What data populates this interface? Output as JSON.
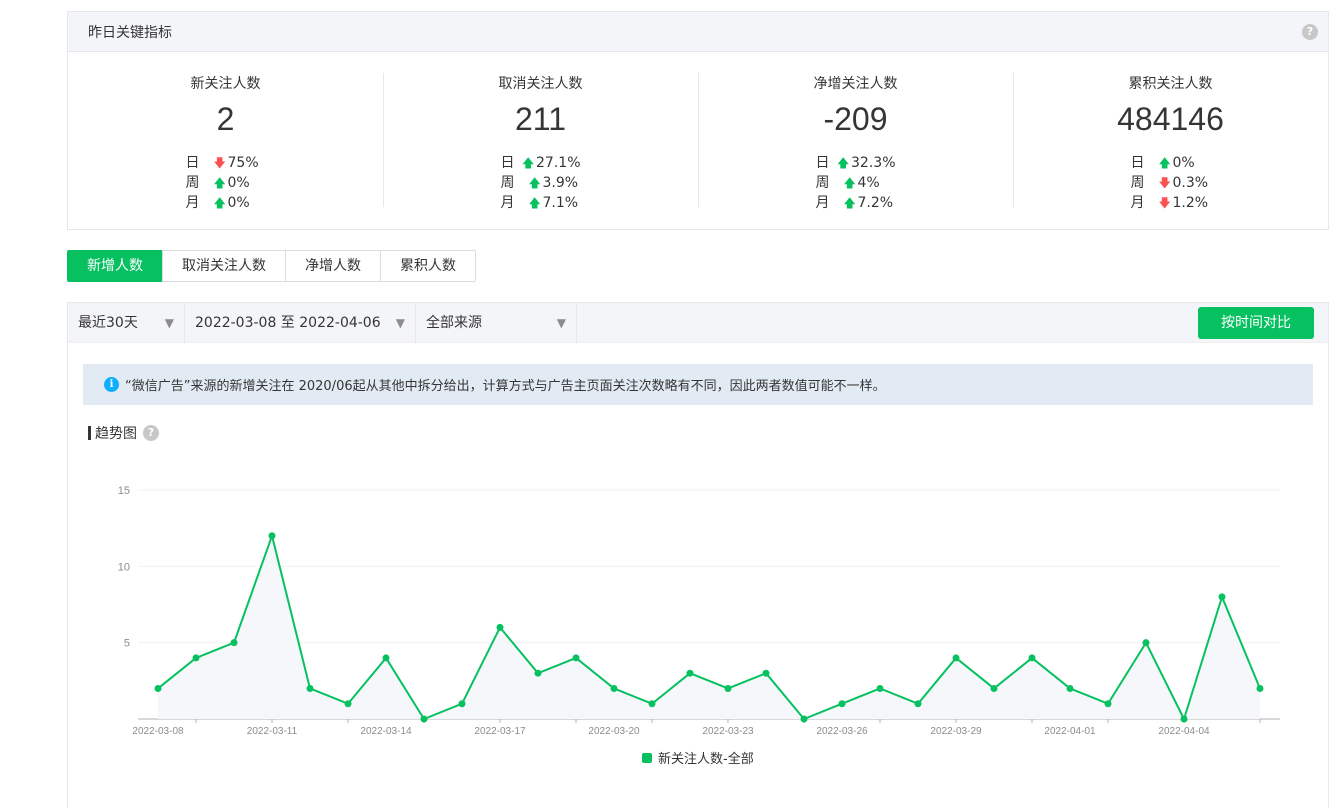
{
  "kpi": {
    "header": "昨日关键指标",
    "help_icon": "?",
    "metrics": [
      {
        "title": "新关注人数",
        "value": "2",
        "changes": [
          {
            "period": "日",
            "direction": "down",
            "pct": "75%"
          },
          {
            "period": "周",
            "direction": "up",
            "pct": "0%"
          },
          {
            "period": "月",
            "direction": "up",
            "pct": "0%"
          }
        ]
      },
      {
        "title": "取消关注人数",
        "value": "211",
        "changes": [
          {
            "period": "日",
            "direction": "up",
            "pct": "27.1%"
          },
          {
            "period": "周",
            "direction": "up",
            "pct": "3.9%"
          },
          {
            "period": "月",
            "direction": "up",
            "pct": "7.1%"
          }
        ]
      },
      {
        "title": "净增关注人数",
        "value": "-209",
        "changes": [
          {
            "period": "日",
            "direction": "up",
            "pct": "32.3%"
          },
          {
            "period": "周",
            "direction": "up",
            "pct": "4%"
          },
          {
            "period": "月",
            "direction": "up",
            "pct": "7.2%"
          }
        ]
      },
      {
        "title": "累积关注人数",
        "value": "484146",
        "changes": [
          {
            "period": "日",
            "direction": "up",
            "pct": "0%"
          },
          {
            "period": "周",
            "direction": "down",
            "pct": "0.3%"
          },
          {
            "period": "月",
            "direction": "down",
            "pct": "1.2%"
          }
        ]
      }
    ]
  },
  "tabs": [
    {
      "label": "新增人数",
      "active": true
    },
    {
      "label": "取消关注人数",
      "active": false
    },
    {
      "label": "净增人数",
      "active": false
    },
    {
      "label": "累积人数",
      "active": false
    }
  ],
  "filters": {
    "range": "最近30天",
    "dates": "2022-03-08 至 2022-04-06",
    "source": "全部来源",
    "compare_button": "按时间对比"
  },
  "notice": {
    "icon": "i",
    "text": "“微信广告”来源的新增关注在 2020/06起从其他中拆分给出，计算方式与广告主页面关注次数略有不同，因此两者数值可能不一样。"
  },
  "trend": {
    "title": "趋势图",
    "help_icon": "?"
  },
  "colors": {
    "accent": "#07c160",
    "down": "#fa5151",
    "notice_bg": "#e2ebf4",
    "info": "#10aeff"
  },
  "chart_data": {
    "type": "line",
    "x": [
      "2022-03-08",
      "2022-03-09",
      "2022-03-10",
      "2022-03-11",
      "2022-03-12",
      "2022-03-13",
      "2022-03-14",
      "2022-03-15",
      "2022-03-16",
      "2022-03-17",
      "2022-03-18",
      "2022-03-19",
      "2022-03-20",
      "2022-03-21",
      "2022-03-22",
      "2022-03-23",
      "2022-03-24",
      "2022-03-25",
      "2022-03-26",
      "2022-03-27",
      "2022-03-28",
      "2022-03-29",
      "2022-03-30",
      "2022-03-31",
      "2022-04-01",
      "2022-04-02",
      "2022-04-03",
      "2022-04-04",
      "2022-04-05",
      "2022-04-06"
    ],
    "x_tick_labels": [
      "2022-03-08",
      "2022-03-11",
      "2022-03-14",
      "2022-03-17",
      "2022-03-20",
      "2022-03-23",
      "2022-03-26",
      "2022-03-29",
      "2022-04-01",
      "2022-04-04"
    ],
    "series": [
      {
        "name": "新关注人数-全部",
        "values": [
          2,
          4,
          5,
          12,
          2,
          1,
          4,
          0,
          1,
          6,
          3,
          4,
          2,
          1,
          3,
          2,
          3,
          0,
          1,
          2,
          1,
          4,
          2,
          4,
          2,
          1,
          5,
          0,
          8,
          2
        ]
      }
    ],
    "ylim": [
      0,
      15
    ],
    "y_ticks": [
      5,
      10,
      15
    ],
    "grid": true,
    "area_fill": true,
    "legend": "bottom"
  }
}
